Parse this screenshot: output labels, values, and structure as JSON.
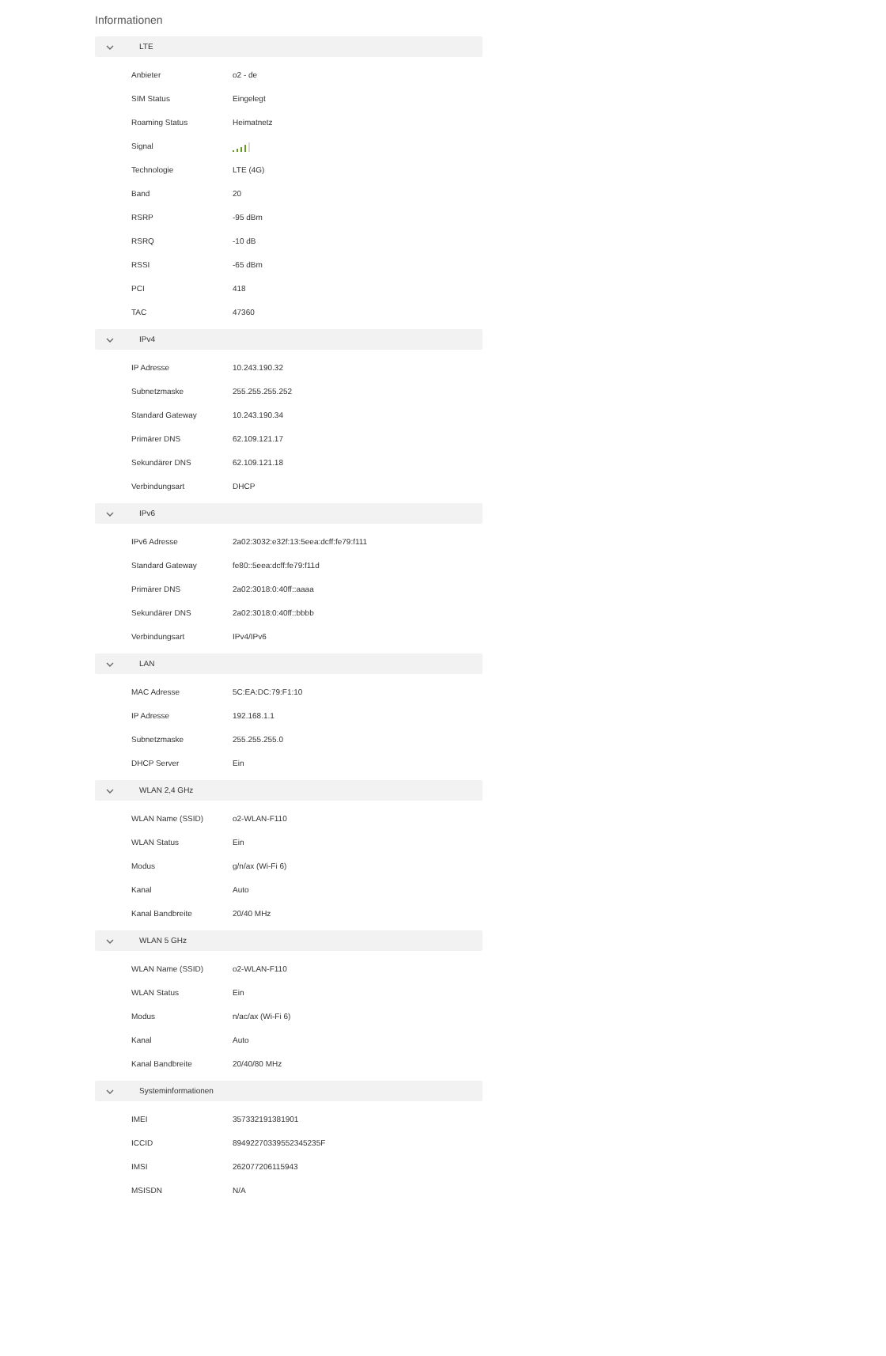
{
  "title": "Informationen",
  "sections": [
    {
      "label": "LTE",
      "expanded": true,
      "rows": [
        {
          "kind": "text",
          "label": "Anbieter",
          "value": "o2 - de"
        },
        {
          "kind": "text",
          "label": "SIM Status",
          "value": "Eingelegt"
        },
        {
          "kind": "text",
          "label": "Roaming Status",
          "value": "Heimatnetz"
        },
        {
          "kind": "signal",
          "label": "Signal"
        },
        {
          "kind": "text",
          "label": "Technologie",
          "value": "LTE (4G)"
        },
        {
          "kind": "text",
          "label": "Band",
          "value": "20"
        },
        {
          "kind": "text",
          "label": "RSRP",
          "value": "-95 dBm"
        },
        {
          "kind": "text",
          "label": "RSRQ",
          "value": "-10 dB"
        },
        {
          "kind": "text",
          "label": "RSSI",
          "value": "-65 dBm"
        },
        {
          "kind": "text",
          "label": "PCI",
          "value": "418"
        },
        {
          "kind": "text",
          "label": "TAC",
          "value": "47360"
        }
      ]
    },
    {
      "label": "IPv4",
      "expanded": true,
      "rows": [
        {
          "kind": "text",
          "label": "IP Adresse",
          "value": "10.243.190.32"
        },
        {
          "kind": "text",
          "label": "Subnetzmaske",
          "value": "255.255.255.252"
        },
        {
          "kind": "text",
          "label": "Standard Gateway",
          "value": "10.243.190.34"
        },
        {
          "kind": "text",
          "label": "Primärer DNS",
          "value": "62.109.121.17"
        },
        {
          "kind": "text",
          "label": "Sekundärer DNS",
          "value": "62.109.121.18"
        },
        {
          "kind": "text",
          "label": "Verbindungsart",
          "value": "DHCP"
        }
      ]
    },
    {
      "label": "IPv6",
      "expanded": true,
      "rows": [
        {
          "kind": "text",
          "label": "IPv6 Adresse",
          "value": "2a02:3032:e32f:13:5eea:dcff:fe79:f111"
        },
        {
          "kind": "text",
          "label": "Standard Gateway",
          "value": "fe80::5eea:dcff:fe79:f11d"
        },
        {
          "kind": "text",
          "label": "Primärer DNS",
          "value": "2a02:3018:0:40ff::aaaa"
        },
        {
          "kind": "text",
          "label": "Sekundärer DNS",
          "value": "2a02:3018:0:40ff::bbbb"
        },
        {
          "kind": "text",
          "label": "Verbindungsart",
          "value": "IPv4/IPv6"
        }
      ]
    },
    {
      "label": "LAN",
      "expanded": true,
      "rows": [
        {
          "kind": "text",
          "label": "MAC Adresse",
          "value": "5C:EA:DC:79:F1:10"
        },
        {
          "kind": "text",
          "label": "IP Adresse",
          "value": "192.168.1.1"
        },
        {
          "kind": "text",
          "label": "Subnetzmaske",
          "value": "255.255.255.0"
        },
        {
          "kind": "text",
          "label": "DHCP Server",
          "value": "Ein"
        }
      ]
    },
    {
      "label": "WLAN 2,4 GHz",
      "expanded": true,
      "rows": [
        {
          "kind": "text",
          "label": "WLAN Name (SSID)",
          "value": "o2-WLAN-F110"
        },
        {
          "kind": "text",
          "label": "WLAN Status",
          "value": "Ein"
        },
        {
          "kind": "text",
          "label": "Modus",
          "value": "g/n/ax (Wi-Fi 6)"
        },
        {
          "kind": "text",
          "label": "Kanal",
          "value": "Auto"
        },
        {
          "kind": "text",
          "label": "Kanal Bandbreite",
          "value": "20/40 MHz"
        }
      ]
    },
    {
      "label": "WLAN 5 GHz",
      "expanded": true,
      "rows": [
        {
          "kind": "text",
          "label": "WLAN Name (SSID)",
          "value": "o2-WLAN-F110"
        },
        {
          "kind": "text",
          "label": "WLAN Status",
          "value": "Ein"
        },
        {
          "kind": "text",
          "label": "Modus",
          "value": "n/ac/ax (Wi-Fi 6)"
        },
        {
          "kind": "text",
          "label": "Kanal",
          "value": "Auto"
        },
        {
          "kind": "text",
          "label": "Kanal Bandbreite",
          "value": "20/40/80 MHz"
        }
      ]
    },
    {
      "label": "Systeminformationen",
      "expanded": true,
      "rows": [
        {
          "kind": "text",
          "label": "IMEI",
          "value": "357332191381901"
        },
        {
          "kind": "text",
          "label": "ICCID",
          "value": "89492270339552345235F"
        },
        {
          "kind": "text",
          "label": "IMSI",
          "value": "262077206115943"
        },
        {
          "kind": "text",
          "label": "MSISDN",
          "value": "N/A"
        }
      ]
    }
  ]
}
